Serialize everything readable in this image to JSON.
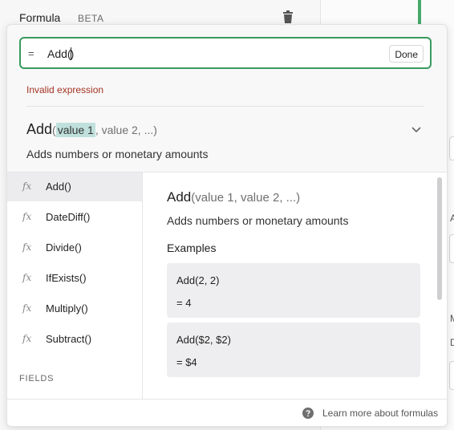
{
  "panel": {
    "title": "Formula",
    "badge": "BETA"
  },
  "background_fragments": {
    "a": "A",
    "m": "M",
    "d": "D"
  },
  "editor": {
    "equals": "=",
    "value_before_caret": "Add(",
    "value_after_caret": ")",
    "done_label": "Done",
    "error": "Invalid expression"
  },
  "signature": {
    "name": "Add",
    "open_paren": "(",
    "highlighted_param": "value 1",
    "rest_params": ", value 2, ...)",
    "description": "Adds numbers or monetary amounts"
  },
  "functions": [
    {
      "icon": "fx",
      "label": "Add()",
      "active": true
    },
    {
      "icon": "fx",
      "label": "DateDiff()"
    },
    {
      "icon": "fx",
      "label": "Divide()"
    },
    {
      "icon": "fx",
      "label": "IfExists()"
    },
    {
      "icon": "fx",
      "label": "Multiply()"
    },
    {
      "icon": "fx",
      "label": "Subtract()"
    }
  ],
  "fields_heading": "FIELDS",
  "detail": {
    "name": "Add",
    "params": "(value 1, value 2, ...)",
    "description": "Adds numbers or monetary amounts",
    "examples_heading": "Examples",
    "examples": [
      {
        "code": "Add(2, 2)",
        "result": "= 4"
      },
      {
        "code": "Add($2, $2)",
        "result": "= $4"
      }
    ]
  },
  "footer": {
    "help_label": "Learn more about formulas"
  },
  "colors": {
    "accent": "#3a9a5e",
    "error": "#a2331f",
    "highlight": "#bfe0dc"
  }
}
